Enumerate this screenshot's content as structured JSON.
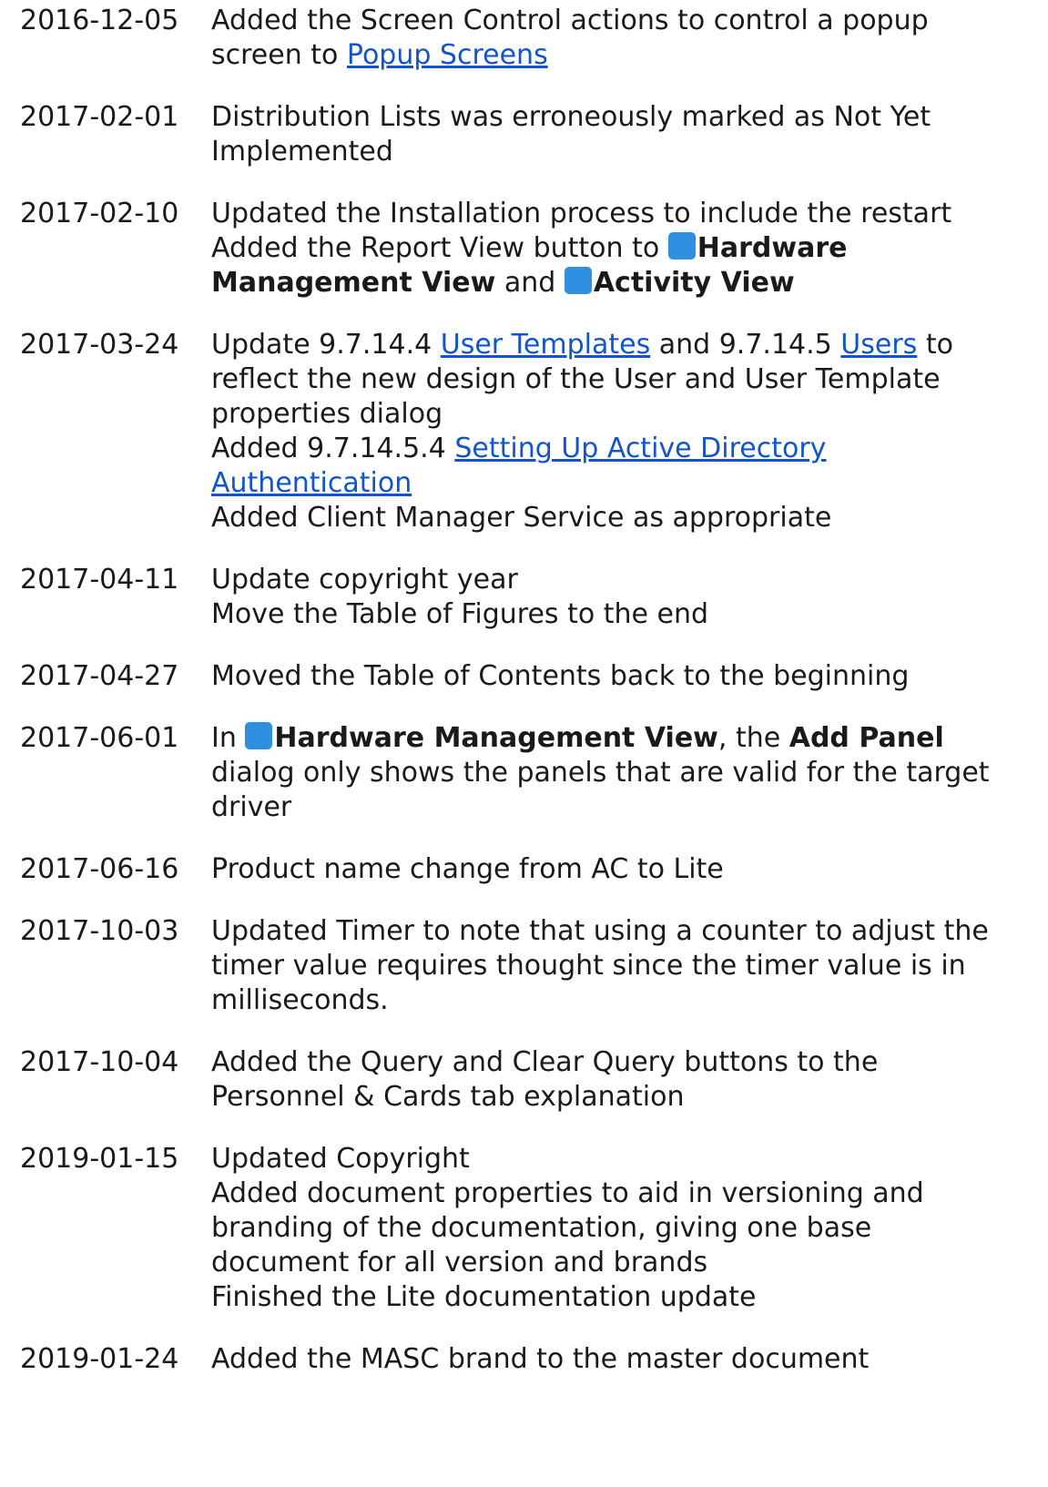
{
  "entries": [
    {
      "date": "2016-12-05",
      "lines": [
        "Added the Screen Control actions to control a popup",
        {
          "pre": "screen to ",
          "link": "Popup Screens"
        }
      ]
    },
    {
      "date": "2017-02-01",
      "lines": [
        "Distribution Lists was erroneously marked as Not Yet",
        "Implemented"
      ]
    },
    {
      "date": "2017-02-10",
      "lines": [
        "Updated the Installation process to include the restart",
        {
          "pre": "Added the Report View button to ",
          "icon": "hardware-management-icon",
          "bold": "Hardware"
        },
        {
          "bold": "Management View",
          "mid": " and ",
          "icon2": "activity-view-icon",
          "bold2": "Activity View"
        }
      ]
    },
    {
      "date": "2017-03-24",
      "lines": [
        {
          "pre": "Update 9.7.14.4 ",
          "link": "User Templates",
          "mid": " and 9.7.14.5 ",
          "link2": "Users",
          "post": " to"
        },
        "reflect the new design of the User and User Template",
        "properties dialog",
        {
          "pre": "Added 9.7.14.5.4 ",
          "link": "Setting Up Active Directory"
        },
        {
          "link": "Authentication"
        },
        "Added Client Manager Service as appropriate"
      ]
    },
    {
      "date": "2017-04-11",
      "lines": [
        "Update copyright year",
        "Move the Table of Figures to the end"
      ]
    },
    {
      "date": "2017-04-27",
      "lines": [
        "Moved the Table of Contents back to the beginning"
      ]
    },
    {
      "date": "2017-06-01",
      "lines": [
        {
          "pre": "In ",
          "icon": "hardware-management-icon",
          "bold": "Hardware Management View",
          "mid": ", the ",
          "bold2": "Add Panel"
        },
        "dialog only shows the panels that are valid for the target",
        "driver"
      ]
    },
    {
      "date": "2017-06-16",
      "lines": [
        "Product name change from AC to Lite"
      ]
    },
    {
      "date": "2017-10-03",
      "lines": [
        "Updated Timer to note that using a counter to adjust the",
        "timer value requires thought since the timer value is in",
        "milliseconds."
      ]
    },
    {
      "date": "2017-10-04",
      "lines": [
        "Added the Query and Clear Query buttons to the",
        "Personnel & Cards tab explanation"
      ]
    },
    {
      "date": "2019-01-15",
      "lines": [
        "Updated Copyright",
        "Added document properties to aid in versioning and",
        "branding of the documentation, giving one base",
        "document for all version and brands",
        "Finished the Lite documentation update"
      ]
    },
    {
      "date": "2019-01-24",
      "lines": [
        "Added the MASC brand to the master document"
      ]
    }
  ]
}
